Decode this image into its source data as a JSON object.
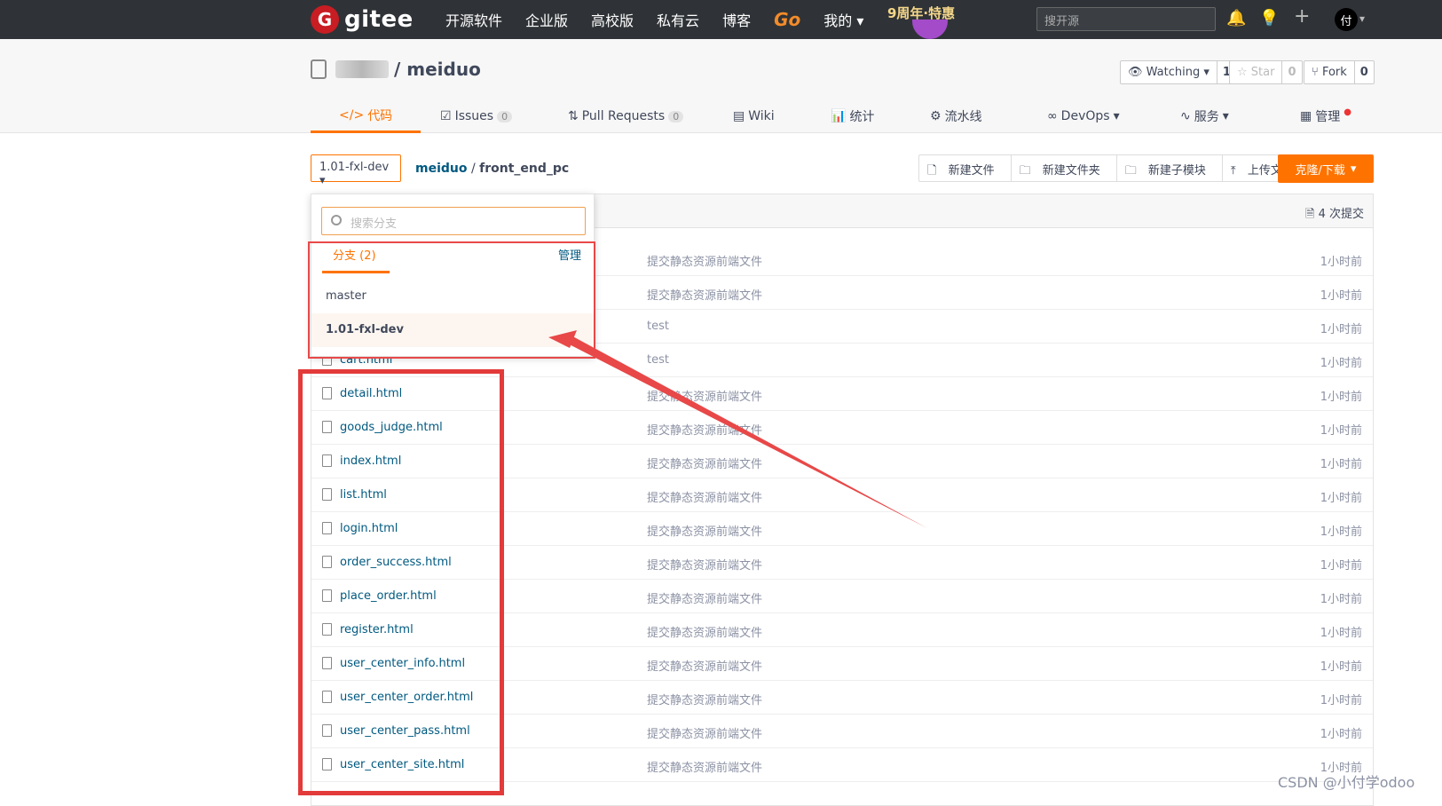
{
  "topbar": {
    "logo_mark": "G",
    "logo_text": "gitee",
    "nav": [
      "开源软件",
      "企业版",
      "高校版",
      "私有云",
      "博客"
    ],
    "go": "Go",
    "mine": "我的",
    "promo": "9周年·特惠",
    "search_placeholder": "搜开源",
    "avatar": "付"
  },
  "repo": {
    "name": "/ meiduo",
    "watch_label": "Watching",
    "watch_count": "1",
    "star_label": "Star",
    "star_count": "0",
    "fork_label": "Fork",
    "fork_count": "0"
  },
  "tabs": {
    "code": "代码",
    "issues": "Issues",
    "issues_count": "0",
    "prs": "Pull Requests",
    "prs_count": "0",
    "wiki": "Wiki",
    "stats": "统计",
    "pipeline": "流水线",
    "devops": "DevOps",
    "service": "服务",
    "manage": "管理"
  },
  "toolbar": {
    "branch": "1.01-fxl-dev",
    "crumb_repo": "meiduo",
    "crumb_sep": "/",
    "crumb_dir": "front_end_pc",
    "new_file": "新建文件",
    "new_folder": "新建文件夹",
    "new_submodule": "新建子模块",
    "upload": "上传文件",
    "clone": "克隆/下载"
  },
  "commits": "4 次提交",
  "dropdown": {
    "search_placeholder": "搜索分支",
    "tab": "分支 (2)",
    "manage": "管理",
    "branches": [
      "master",
      "1.01-fxl-dev"
    ]
  },
  "files": [
    {
      "name": "",
      "msg": "提交静态资源前端文件",
      "time": "1小时前"
    },
    {
      "name": "",
      "msg": "提交静态资源前端文件",
      "time": "1小时前"
    },
    {
      "name": "",
      "msg": "test",
      "time": "1小时前"
    },
    {
      "name": "cart.html",
      "msg": "test",
      "time": "1小时前"
    },
    {
      "name": "detail.html",
      "msg": "提交静态资源前端文件",
      "time": "1小时前"
    },
    {
      "name": "goods_judge.html",
      "msg": "提交静态资源前端文件",
      "time": "1小时前"
    },
    {
      "name": "index.html",
      "msg": "提交静态资源前端文件",
      "time": "1小时前"
    },
    {
      "name": "list.html",
      "msg": "提交静态资源前端文件",
      "time": "1小时前"
    },
    {
      "name": "login.html",
      "msg": "提交静态资源前端文件",
      "time": "1小时前"
    },
    {
      "name": "order_success.html",
      "msg": "提交静态资源前端文件",
      "time": "1小时前"
    },
    {
      "name": "place_order.html",
      "msg": "提交静态资源前端文件",
      "time": "1小时前"
    },
    {
      "name": "register.html",
      "msg": "提交静态资源前端文件",
      "time": "1小时前"
    },
    {
      "name": "user_center_info.html",
      "msg": "提交静态资源前端文件",
      "time": "1小时前"
    },
    {
      "name": "user_center_order.html",
      "msg": "提交静态资源前端文件",
      "time": "1小时前"
    },
    {
      "name": "user_center_pass.html",
      "msg": "提交静态资源前端文件",
      "time": "1小时前"
    },
    {
      "name": "user_center_site.html",
      "msg": "提交静态资源前端文件",
      "time": "1小时前"
    }
  ],
  "watermark": "CSDN @小付学odoo"
}
